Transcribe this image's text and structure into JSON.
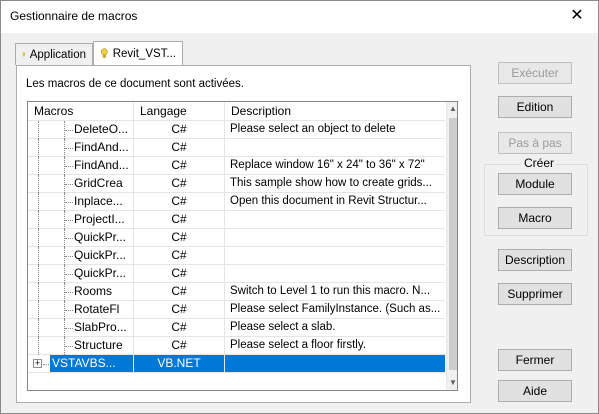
{
  "window": {
    "title": "Gestionnaire de macros",
    "close_symbol": "✕"
  },
  "tabs": [
    {
      "label": "Application"
    },
    {
      "label": "Revit_VST..."
    }
  ],
  "panel": {
    "info_text": "Les macros de ce document sont activées."
  },
  "tree": {
    "headers": {
      "macros": "Macros",
      "langage": "Langage",
      "description": "Description"
    },
    "rows": [
      {
        "name": "DeleteO...",
        "lang": "C#",
        "desc": "Please select an object to delete"
      },
      {
        "name": "FindAnd...",
        "lang": "C#",
        "desc": ""
      },
      {
        "name": "FindAnd...",
        "lang": "C#",
        "desc": "Replace window 16\" x 24\" to 36\" x 72\""
      },
      {
        "name": "GridCrea",
        "lang": "C#",
        "desc": "This sample show how to create grids..."
      },
      {
        "name": "Inplace...",
        "lang": "C#",
        "desc": "Open this document in Revit Structur..."
      },
      {
        "name": "ProjectI...",
        "lang": "C#",
        "desc": ""
      },
      {
        "name": "QuickPr...",
        "lang": "C#",
        "desc": ""
      },
      {
        "name": "QuickPr...",
        "lang": "C#",
        "desc": ""
      },
      {
        "name": "QuickPr...",
        "lang": "C#",
        "desc": ""
      },
      {
        "name": "Rooms",
        "lang": "C#",
        "desc": "Switch to Level 1 to run this macro. N..."
      },
      {
        "name": "RotateFl",
        "lang": "C#",
        "desc": "Please select FamilyInstance. (Such as..."
      },
      {
        "name": "SlabPro...",
        "lang": "C#",
        "desc": "Please select a slab."
      },
      {
        "name": "Structure",
        "lang": "C#",
        "desc": "Please select a floor firstly."
      }
    ],
    "root_row": {
      "name": "VSTAVBS...",
      "lang": "VB.NET",
      "desc": "",
      "expander": "+"
    }
  },
  "buttons": {
    "executer": "Exécuter",
    "edition": "Edition",
    "pas_a_pas": "Pas à pas",
    "creer_group": "Créer",
    "module": "Module",
    "macro": "Macro",
    "description": "Description",
    "supprimer": "Supprimer",
    "fermer": "Fermer",
    "aide": "Aide"
  },
  "colors": {
    "selection": "#0078d7",
    "bulb": "#e8c230"
  }
}
